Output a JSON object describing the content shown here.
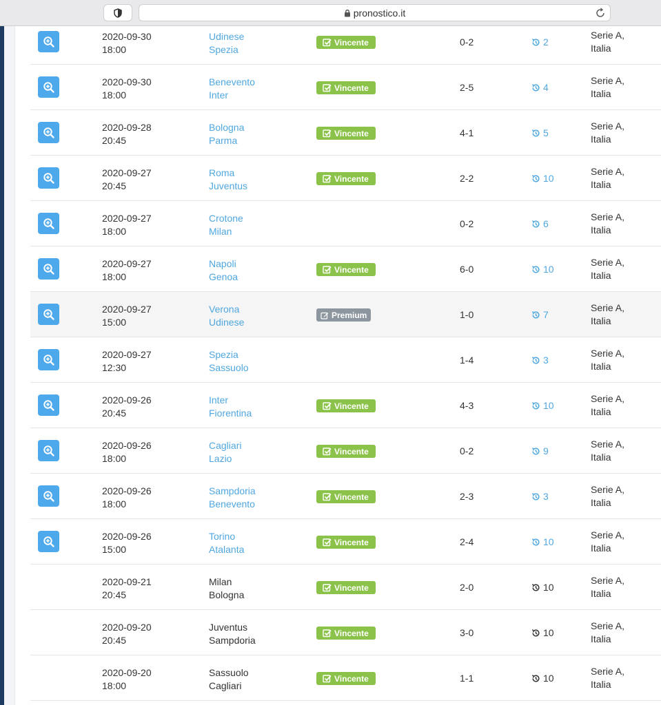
{
  "browser": {
    "url": "pronostico.it"
  },
  "colors": {
    "accent_link": "#4fa7e0",
    "zoom_button": "#4ea8ec",
    "badge_vincente": "#8bc34a",
    "badge_premium": "#8d969e",
    "sidebar_navy": "#1d3b63"
  },
  "icons": {
    "zoom": "zoom-in-icon",
    "vincente": "check-square-icon",
    "premium": "edit-icon",
    "history": "history-icon",
    "shield": "shield-icon",
    "lock": "lock-icon",
    "reload": "reload-icon"
  },
  "matches": [
    {
      "date": "2020-09-30",
      "time": "18:00",
      "home": "Udinese",
      "away": "Spezia",
      "badge": "Vincente",
      "score": "0-2",
      "count": "2",
      "league_line1": "Serie A,",
      "league_line2": "Italia"
    },
    {
      "date": "2020-09-30",
      "time": "18:00",
      "home": "Benevento",
      "away": "Inter",
      "badge": "Vincente",
      "score": "2-5",
      "count": "4",
      "league_line1": "Serie A,",
      "league_line2": "Italia"
    },
    {
      "date": "2020-09-28",
      "time": "20:45",
      "home": "Bologna",
      "away": "Parma",
      "badge": "Vincente",
      "score": "4-1",
      "count": "5",
      "league_line1": "Serie A,",
      "league_line2": "Italia"
    },
    {
      "date": "2020-09-27",
      "time": "20:45",
      "home": "Roma",
      "away": "Juventus",
      "badge": "Vincente",
      "score": "2-2",
      "count": "10",
      "league_line1": "Serie A,",
      "league_line2": "Italia"
    },
    {
      "date": "2020-09-27",
      "time": "18:00",
      "home": "Crotone",
      "away": "Milan",
      "badge": "",
      "score": "0-2",
      "count": "6",
      "league_line1": "Serie A,",
      "league_line2": "Italia"
    },
    {
      "date": "2020-09-27",
      "time": "18:00",
      "home": "Napoli",
      "away": "Genoa",
      "badge": "Vincente",
      "score": "6-0",
      "count": "10",
      "league_line1": "Serie A,",
      "league_line2": "Italia"
    },
    {
      "date": "2020-09-27",
      "time": "15:00",
      "home": "Verona",
      "away": "Udinese",
      "badge": "Premium",
      "score": "1-0",
      "count": "7",
      "league_line1": "Serie A,",
      "league_line2": "Italia"
    },
    {
      "date": "2020-09-27",
      "time": "12:30",
      "home": "Spezia",
      "away": "Sassuolo",
      "badge": "",
      "score": "1-4",
      "count": "3",
      "league_line1": "Serie A,",
      "league_line2": "Italia"
    },
    {
      "date": "2020-09-26",
      "time": "20:45",
      "home": "Inter",
      "away": "Fiorentina",
      "badge": "Vincente",
      "score": "4-3",
      "count": "10",
      "league_line1": "Serie A,",
      "league_line2": "Italia"
    },
    {
      "date": "2020-09-26",
      "time": "18:00",
      "home": "Cagliari",
      "away": "Lazio",
      "badge": "Vincente",
      "score": "0-2",
      "count": "9",
      "league_line1": "Serie A,",
      "league_line2": "Italia"
    },
    {
      "date": "2020-09-26",
      "time": "18:00",
      "home": "Sampdoria",
      "away": "Benevento",
      "badge": "Vincente",
      "score": "2-3",
      "count": "3",
      "league_line1": "Serie A,",
      "league_line2": "Italia"
    },
    {
      "date": "2020-09-26",
      "time": "15:00",
      "home": "Torino",
      "away": "Atalanta",
      "badge": "Vincente",
      "score": "2-4",
      "count": "10",
      "league_line1": "Serie A,",
      "league_line2": "Italia"
    },
    {
      "date": "2020-09-21",
      "time": "20:45",
      "home": "Milan",
      "away": "Bologna",
      "badge": "Vincente",
      "score": "2-0",
      "count": "10",
      "league_line1": "Serie A,",
      "league_line2": "Italia"
    },
    {
      "date": "2020-09-20",
      "time": "20:45",
      "home": "Juventus",
      "away": "Sampdoria",
      "badge": "Vincente",
      "score": "3-0",
      "count": "10",
      "league_line1": "Serie A,",
      "league_line2": "Italia"
    },
    {
      "date": "2020-09-20",
      "time": "18:00",
      "home": "Sassuolo",
      "away": "Cagliari",
      "badge": "Vincente",
      "score": "1-1",
      "count": "10",
      "league_line1": "Serie A,",
      "league_line2": "Italia"
    }
  ]
}
